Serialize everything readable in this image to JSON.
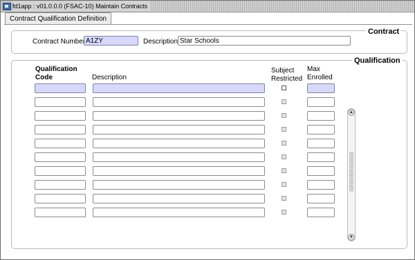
{
  "window": {
    "title": "fd1app : v01.0.0.0 (FSAC-10) Maintain Contracts"
  },
  "tab": {
    "label": "Contract Qualification Definition"
  },
  "contract": {
    "group_label": "Contract",
    "number_label": "Contract Number",
    "number_value": "A1ZY",
    "description_label": "Description",
    "description_value": "Star Schools"
  },
  "qualification": {
    "group_label": "Qualification",
    "headers": {
      "code_line1": "Qualification",
      "code_line2": "Code",
      "description": "Description",
      "subject_line1": "Subject",
      "subject_line2": "Restricted",
      "max_line1": "Max",
      "max_line2": "Enrolled"
    },
    "rows": [
      {
        "code": "",
        "description": "",
        "subject_restricted": false,
        "max_enrolled": ""
      },
      {
        "code": "",
        "description": "",
        "subject_restricted": false,
        "max_enrolled": ""
      },
      {
        "code": "",
        "description": "",
        "subject_restricted": false,
        "max_enrolled": ""
      },
      {
        "code": "",
        "description": "",
        "subject_restricted": false,
        "max_enrolled": ""
      },
      {
        "code": "",
        "description": "",
        "subject_restricted": false,
        "max_enrolled": ""
      },
      {
        "code": "",
        "description": "",
        "subject_restricted": false,
        "max_enrolled": ""
      },
      {
        "code": "",
        "description": "",
        "subject_restricted": false,
        "max_enrolled": ""
      },
      {
        "code": "",
        "description": "",
        "subject_restricted": false,
        "max_enrolled": ""
      },
      {
        "code": "",
        "description": "",
        "subject_restricted": false,
        "max_enrolled": ""
      },
      {
        "code": "",
        "description": "",
        "subject_restricted": false,
        "max_enrolled": ""
      }
    ]
  },
  "icons": {
    "app": "app-window-icon",
    "scroll_up": "scroll-up-arrow-icon",
    "scroll_down": "scroll-down-arrow-icon"
  },
  "colors": {
    "current_field_bg": "#d8d8fa",
    "titlebar_bg": "#d4d4d4"
  }
}
